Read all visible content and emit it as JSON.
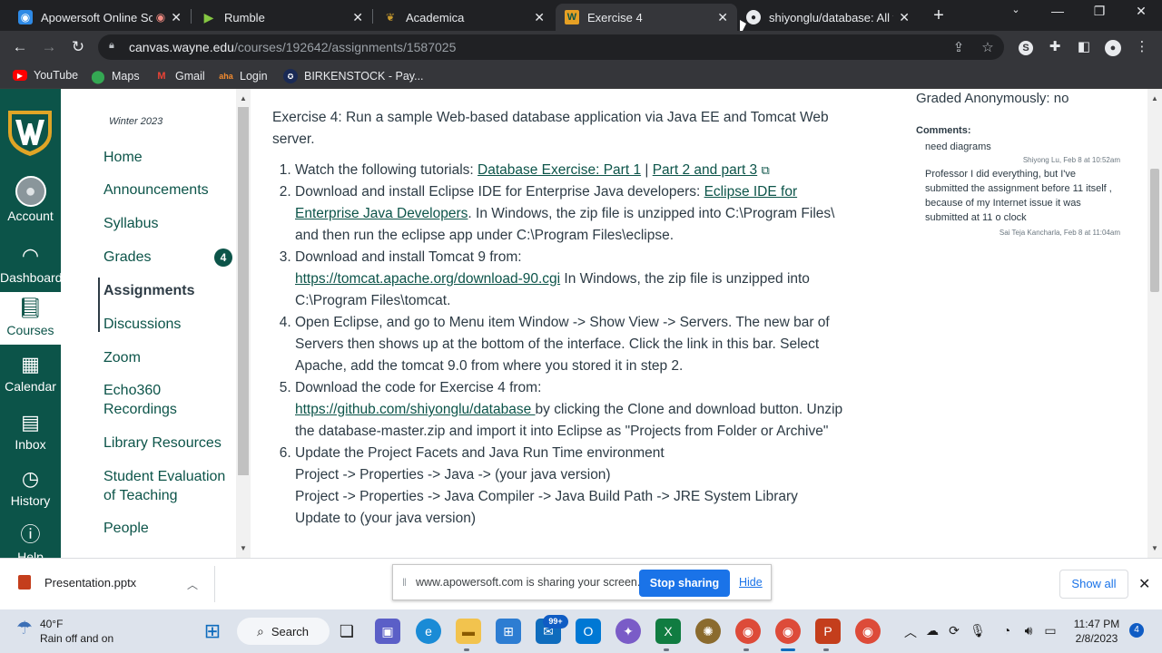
{
  "browser": {
    "tabs": [
      {
        "title": "Apowersoft Online Sc",
        "favicon": "apowersoft-icon"
      },
      {
        "title": "Rumble",
        "favicon": "rumble-icon"
      },
      {
        "title": "Academica",
        "favicon": "academica-icon"
      },
      {
        "title": "Exercise 4",
        "favicon": "canvas-icon"
      },
      {
        "title": "shiyonglu/database: All fil",
        "favicon": "github-icon"
      }
    ],
    "url_host": "canvas.wayne.edu",
    "url_path": "/courses/192642/assignments/1587025",
    "bookmarks": [
      {
        "label": "YouTube"
      },
      {
        "label": "Maps"
      },
      {
        "label": "Gmail"
      },
      {
        "label": "Login"
      },
      {
        "label": "BIRKENSTOCK - Pay..."
      }
    ]
  },
  "global_nav": {
    "items": [
      {
        "label": "Account"
      },
      {
        "label": "Dashboard"
      },
      {
        "label": "Courses"
      },
      {
        "label": "Calendar"
      },
      {
        "label": "Inbox"
      },
      {
        "label": "History"
      },
      {
        "label": "Help"
      }
    ],
    "brand_color": "#0c5449"
  },
  "course_nav": {
    "term": "Winter 2023",
    "items": [
      {
        "label": "Home"
      },
      {
        "label": "Announcements"
      },
      {
        "label": "Syllabus"
      },
      {
        "label": "Grades",
        "badge": "4"
      },
      {
        "label": "Assignments"
      },
      {
        "label": "Discussions"
      },
      {
        "label": "Zoom"
      },
      {
        "label": "Echo360 Recordings"
      },
      {
        "label": "Library Resources"
      },
      {
        "label": "Student Evaluation of Teaching"
      },
      {
        "label": "People"
      }
    ]
  },
  "assignment": {
    "intro": "Exercise 4: Run a sample Web-based database application via Java EE and Tomcat Web server.",
    "steps": {
      "s1_text": "Watch the following tutorials: ",
      "s1_link1": "Database Exercise: Part 1",
      "s1_sep": " | ",
      "s1_link2": "Part 2 and part 3",
      "s2_text": "Download and install Eclipse IDE for Enterprise Java developers: ",
      "s2_link": "Eclipse IDE for Enterprise Java Developers",
      "s2_rest": ". In Windows, the zip file is unzipped into C:\\Program Files\\ and then run the eclipse app under C:\\Program Files\\eclipse.",
      "s3_text": "Download and install Tomcat 9 from:",
      "s3_link": "https://tomcat.apache.org/download-90.cgi",
      "s3_rest": " In Windows, the zip file is unzipped into C:\\Program Files\\tomcat.",
      "s4_text": "Open Eclipse, and go to Menu item Window -> Show View -> Servers. The new bar of Servers then shows up at the bottom of the interface. Click the link in this bar. Select Apache, add the tomcat 9.0 from where you stored it in step 2.",
      "s5_text": "Download the code for Exercise 4 from:",
      "s5_link": "https://github.com/shiyonglu/database ",
      "s5_rest": "by clicking the Clone and download button. Unzip the database-master.zip and import it into Eclipse as \"Projects from Folder or Archive\"",
      "s6_line1": "Update the Project Facets and Java Run Time environment",
      "s6_line2": "Project -> Properties -> Java -> (your java version)",
      "s6_line3": "Project -> Properties -> Java Compiler -> Java Build Path -> JRE System Library",
      "s6_line4": "Update to (your java version)"
    }
  },
  "sidebar": {
    "graded": "Graded Anonymously: no",
    "comments_heading": "Comments:",
    "comments": [
      {
        "text": "need diagrams",
        "meta": "Shiyong Lu, Feb 8 at 10:52am"
      },
      {
        "text": "Professor I did everything, but I've submitted the assignment before 11 itself , because of my Internet issue it was submitted at 11 o clock",
        "meta": "Sai Teja Kancharla, Feb 8 at 11:04am"
      }
    ]
  },
  "download_bar": {
    "file": "Presentation.pptx",
    "share_message": "www.apowersoft.com is sharing your screen.",
    "stop_label": "Stop sharing",
    "hide_label": "Hide",
    "show_all_label": "Show all"
  },
  "taskbar": {
    "weather_temp": "40°F",
    "weather_desc": "Rain off and on",
    "search_label": "Search",
    "mail_badge": "99+",
    "time": "11:47 PM",
    "date": "2/8/2023",
    "notifications": "4"
  }
}
